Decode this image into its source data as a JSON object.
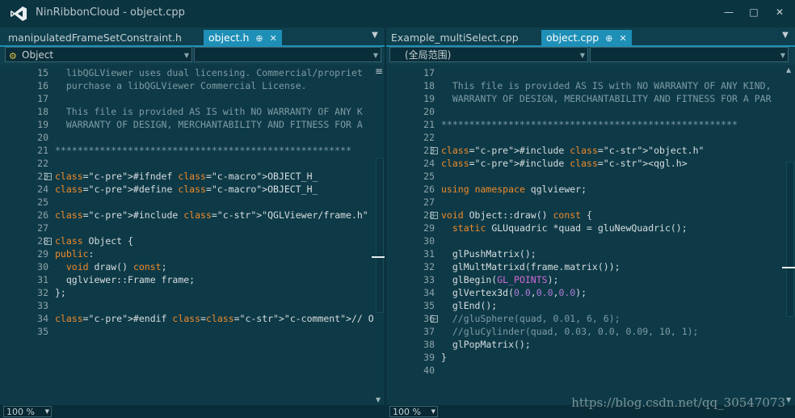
{
  "window": {
    "title": "NinRibbonCloud - object.cpp"
  },
  "left_pane": {
    "tabs": [
      {
        "label": "manipulatedFrameSetConstraint.h",
        "active": false
      },
      {
        "label": "object.h",
        "active": true
      }
    ],
    "nav_scope": "Object",
    "nav_member": "",
    "zoom": "100 %",
    "lines": [
      {
        "n": "15",
        "text": "  libQGLViewer uses dual licensing. Commercial/propriet",
        "cls": "c-comment"
      },
      {
        "n": "16",
        "text": "  purchase a libQGLViewer Commercial License.",
        "cls": "c-comment"
      },
      {
        "n": "17",
        "text": "",
        "cls": ""
      },
      {
        "n": "18",
        "text": "  This file is provided AS IS with NO WARRANTY OF ANY K",
        "cls": "c-comment"
      },
      {
        "n": "19",
        "text": "  WARRANTY OF DESIGN, MERCHANTABILITY AND FITNESS FOR A",
        "cls": "c-comment"
      },
      {
        "n": "20",
        "text": "",
        "cls": ""
      },
      {
        "n": "21",
        "text": "*****************************************************",
        "cls": "c-comment"
      },
      {
        "n": "22",
        "text": "",
        "cls": ""
      },
      {
        "n": "23",
        "text": "#ifndef OBJECT_H_",
        "cls": "pre-ifndef"
      },
      {
        "n": "24",
        "text": "#define OBJECT_H_",
        "cls": "pre-define"
      },
      {
        "n": "25",
        "text": "",
        "cls": ""
      },
      {
        "n": "26",
        "text": "#include \"QGLViewer/frame.h\"",
        "cls": "pre-include"
      },
      {
        "n": "27",
        "text": "",
        "cls": ""
      },
      {
        "n": "28",
        "text": "class Object {",
        "cls": "class"
      },
      {
        "n": "29",
        "text": "public:",
        "cls": "public"
      },
      {
        "n": "30",
        "text": "  void draw() const;",
        "cls": "method"
      },
      {
        "n": "31",
        "text": "  qglviewer::Frame frame;",
        "cls": "member"
      },
      {
        "n": "32",
        "text": "};",
        "cls": ""
      },
      {
        "n": "33",
        "text": "",
        "cls": ""
      },
      {
        "n": "34",
        "text": "#endif // OBJECT_H_",
        "cls": "endif"
      },
      {
        "n": "35",
        "text": "",
        "cls": ""
      }
    ]
  },
  "right_pane": {
    "tabs": [
      {
        "label": "Example_multiSelect.cpp",
        "active": false
      },
      {
        "label": "object.cpp",
        "active": true
      }
    ],
    "nav_scope": "(全局范围)",
    "nav_member": "",
    "zoom": "100 %",
    "lines": [
      {
        "n": "17",
        "text": "",
        "cls": ""
      },
      {
        "n": "18",
        "text": "  This file is provided AS IS with NO WARRANTY OF ANY KIND,",
        "cls": "c-comment"
      },
      {
        "n": "19",
        "text": "  WARRANTY OF DESIGN, MERCHANTABILITY AND FITNESS FOR A PAR",
        "cls": "c-comment"
      },
      {
        "n": "20",
        "text": "",
        "cls": ""
      },
      {
        "n": "21",
        "text": "*****************************************************",
        "cls": "c-comment"
      },
      {
        "n": "22",
        "text": "",
        "cls": ""
      },
      {
        "n": "23",
        "text": "#include \"object.h\"",
        "cls": "inc1"
      },
      {
        "n": "24",
        "text": "#include <qgl.h>",
        "cls": "inc2"
      },
      {
        "n": "25",
        "text": "",
        "cls": ""
      },
      {
        "n": "26",
        "text": "using namespace qglviewer;",
        "cls": "using"
      },
      {
        "n": "27",
        "text": "",
        "cls": ""
      },
      {
        "n": "28",
        "text": "void Object::draw() const {",
        "cls": "fn"
      },
      {
        "n": "29",
        "text": "  static GLUquadric *quad = gluNewQuadric();",
        "cls": "static"
      },
      {
        "n": "30",
        "text": "",
        "cls": ""
      },
      {
        "n": "31",
        "text": "  glPushMatrix();",
        "cls": ""
      },
      {
        "n": "32",
        "text": "  glMultMatrixd(frame.matrix());",
        "cls": ""
      },
      {
        "n": "33",
        "text": "  glBegin(GL_POINTS);",
        "cls": "begin"
      },
      {
        "n": "34",
        "text": "  glVertex3d(0.0,0.0,0.0);",
        "cls": "vertex"
      },
      {
        "n": "35",
        "text": "  glEnd();",
        "cls": ""
      },
      {
        "n": "36",
        "text": "  //gluSphere(quad, 0.01, 6, 6);",
        "cls": "c-comment"
      },
      {
        "n": "37",
        "text": "  //gluCylinder(quad, 0.03, 0.0, 0.09, 10, 1);",
        "cls": "c-comment"
      },
      {
        "n": "38",
        "text": "  glPopMatrix();",
        "cls": ""
      },
      {
        "n": "39",
        "text": "}",
        "cls": ""
      },
      {
        "n": "40",
        "text": "",
        "cls": ""
      }
    ]
  },
  "watermark": "https://blog.csdn.net/qq_30547073",
  "colors": {
    "accent": "#1e8fb6",
    "keyword": "#f08a2a",
    "macro": "#d268d6",
    "comment": "#7d9ba4"
  }
}
